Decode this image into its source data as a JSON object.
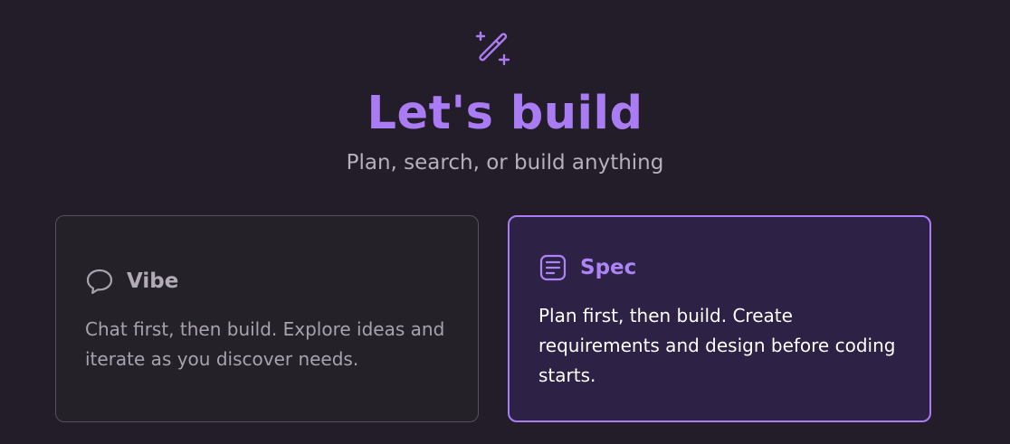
{
  "header": {
    "icon": "magic-wand-sparkle-icon",
    "title": "Let's build",
    "subtitle": "Plan, search, or build anything"
  },
  "modes": [
    {
      "icon": "chat-bubble-icon",
      "title": "Vibe",
      "description": "Chat first, then build. Explore ideas and iterate as you discover needs.",
      "selected": false
    },
    {
      "icon": "document-lines-icon",
      "title": "Spec",
      "description": "Plan first, then build. Create requirements and design before coding starts.",
      "selected": true
    }
  ],
  "colors": {
    "background": "#221d28",
    "accent": "#a97cf4",
    "card_default_bg": "#252129",
    "card_selected_bg": "#2d2145"
  }
}
